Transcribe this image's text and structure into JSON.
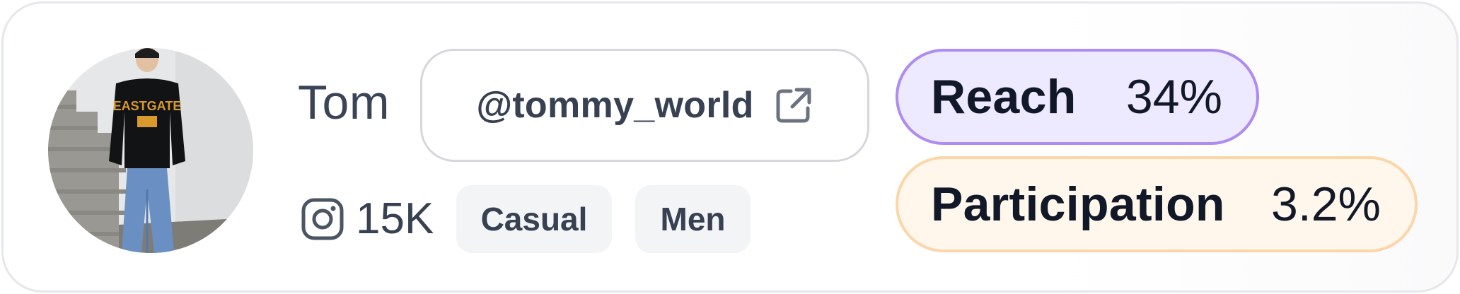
{
  "profile": {
    "name": "Tom",
    "handle": "@tommy_world",
    "platform_icon": "instagram-icon",
    "followers": "15K",
    "tags": [
      "Casual",
      "Men"
    ]
  },
  "metrics": {
    "reach": {
      "label": "Reach",
      "value": "34%"
    },
    "participation": {
      "label": "Participation",
      "value": "3.2%"
    }
  },
  "icons": {
    "external_link": "external-link-icon",
    "avatar": "avatar"
  },
  "colors": {
    "reach_bg": "#ede9fe",
    "reach_border": "#ae8cf0",
    "participation_bg": "#fff7ec",
    "participation_border": "#fcd6a8",
    "text_dark": "#111827",
    "text_gray": "#374151"
  }
}
